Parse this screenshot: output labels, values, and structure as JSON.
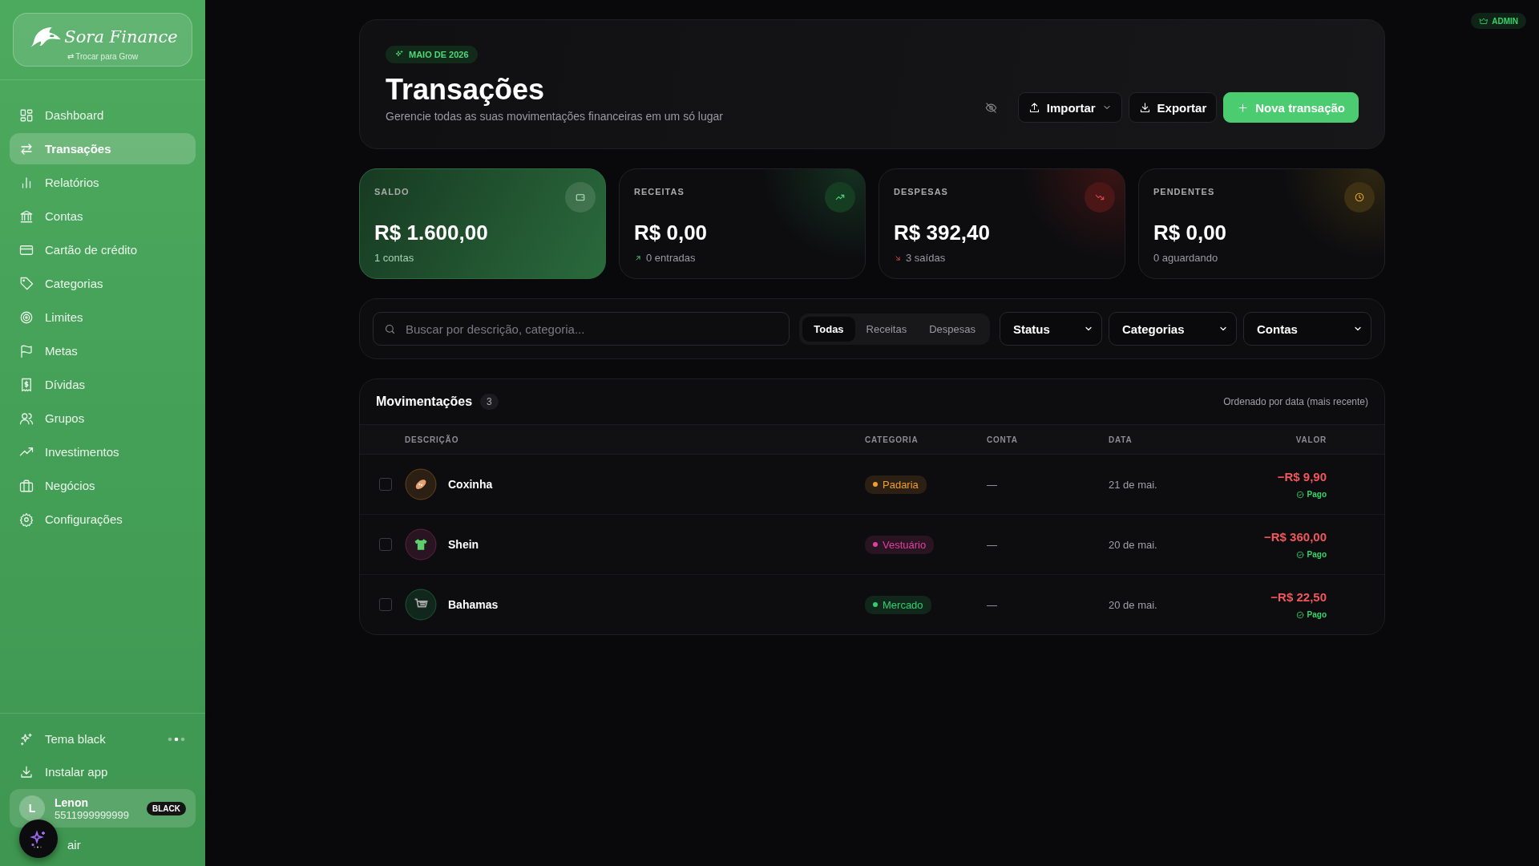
{
  "sidebar": {
    "brand": "Sora Finance",
    "switch_link": "⇄ Trocar para Grow",
    "items": [
      {
        "label": "Dashboard",
        "selected": false
      },
      {
        "label": "Transações",
        "selected": true
      },
      {
        "label": "Relatórios",
        "selected": false
      },
      {
        "label": "Contas",
        "selected": false
      },
      {
        "label": "Cartão de crédito",
        "selected": false
      },
      {
        "label": "Categorias",
        "selected": false
      },
      {
        "label": "Limites",
        "selected": false
      },
      {
        "label": "Metas",
        "selected": false
      },
      {
        "label": "Dívidas",
        "selected": false
      },
      {
        "label": "Grupos",
        "selected": false
      },
      {
        "label": "Investimentos",
        "selected": false
      },
      {
        "label": "Negócios",
        "selected": false
      },
      {
        "label": "Configurações",
        "selected": false
      }
    ],
    "theme_label": "Tema black",
    "install_label": "Instalar app",
    "user": {
      "initial": "L",
      "name": "Lenon",
      "phone": "5511999999999",
      "plan": "BLACK"
    },
    "logout_label": "air"
  },
  "admin_badge": "ADMIN",
  "header": {
    "period": "MAIO DE 2026",
    "title": "Transações",
    "subtitle": "Gerencie todas as suas movimentações financeiras em um só lugar",
    "buttons": [
      {
        "label": "Importar",
        "kind": "dropdown"
      },
      {
        "label": "Exportar",
        "kind": "plain"
      },
      {
        "label": "Nova transação",
        "kind": "primary"
      }
    ]
  },
  "cards": [
    {
      "label": "SALDO",
      "value": "R$ 1.600,00",
      "note": "1 contas",
      "kind": "balance"
    },
    {
      "label": "RECEITAS",
      "value": "R$ 0,00",
      "note": "0 entradas",
      "kind": "income"
    },
    {
      "label": "DESPESAS",
      "value": "R$ 392,40",
      "note": "3 saídas",
      "kind": "expense"
    },
    {
      "label": "PENDENTES",
      "value": "R$ 0,00",
      "note": "0 aguardando",
      "kind": "pending"
    }
  ],
  "filters": {
    "search_placeholder": "Buscar por descrição, categoria...",
    "tabs": [
      {
        "label": "Todas",
        "selected": true
      },
      {
        "label": "Receitas",
        "selected": false
      },
      {
        "label": "Despesas",
        "selected": false
      }
    ],
    "selects": [
      "Status",
      "Categorias",
      "Contas"
    ]
  },
  "table": {
    "title": "Movimentações",
    "count": "3",
    "sort_note": "Ordenado por data (mais recente)",
    "columns": [
      "DESCRIÇÃO",
      "CATEGORIA",
      "CONTA",
      "DATA",
      "VALOR"
    ],
    "rows": [
      {
        "checked": false,
        "description": "Coxinha",
        "category": "Padaria",
        "color": "#f0a030",
        "account": "—",
        "date": "21 de mai.",
        "value": "−R$ 9,90",
        "status": "Pago"
      },
      {
        "checked": false,
        "description": "Shein",
        "category": "Vestuário",
        "color": "#e040a0",
        "account": "—",
        "date": "20 de mai.",
        "value": "−R$ 360,00",
        "status": "Pago"
      },
      {
        "checked": false,
        "description": "Bahamas",
        "category": "Mercado",
        "color": "#30d070",
        "account": "—",
        "date": "20 de mai.",
        "value": "−R$ 22,50",
        "status": "Pago"
      }
    ]
  }
}
